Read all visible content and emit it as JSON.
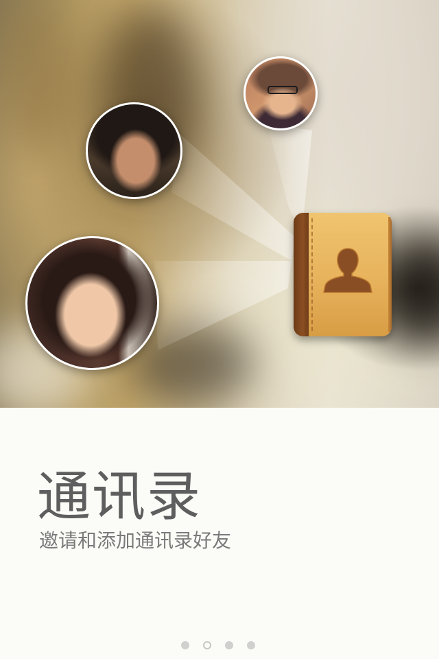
{
  "onboarding": {
    "title": "通讯录",
    "subtitle": "邀请和添加通讯录好友",
    "hero": {
      "book_icon": "contacts-book-icon",
      "avatars": [
        "friend-avatar",
        "friend-avatar",
        "friend-avatar"
      ]
    },
    "pager": {
      "total": 4,
      "active_index": 2
    }
  }
}
